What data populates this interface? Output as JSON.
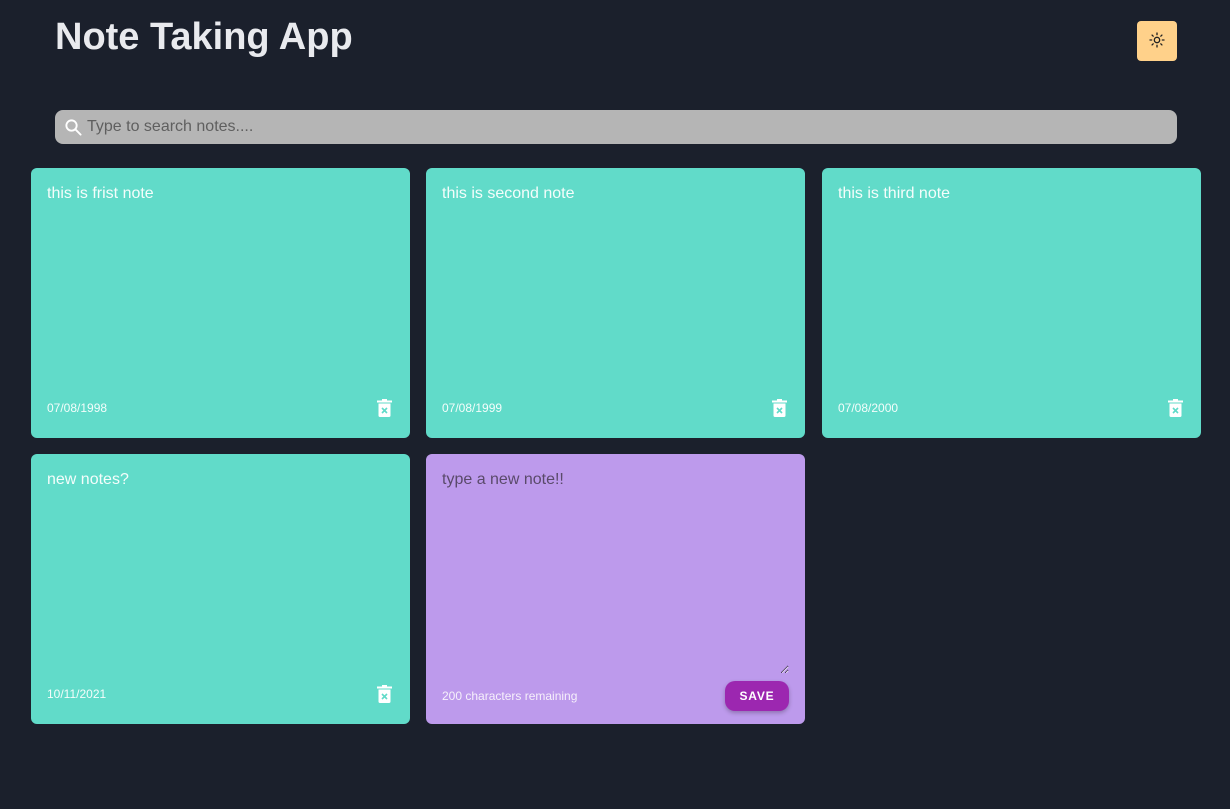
{
  "app": {
    "title": "Note Taking App",
    "theme_toggle_icon": "sun-icon"
  },
  "colors": {
    "background": "#1b202c",
    "note_card": "#61dbc9",
    "new_note_card": "#bd9aec",
    "save_button": "#9c27b0",
    "theme_toggle": "#ffd18a",
    "search_bg": "#b5b5b5"
  },
  "search": {
    "icon": "search-icon",
    "placeholder": "Type to search notes...."
  },
  "notes": [
    {
      "text": "this is frist note",
      "date": "07/08/1998",
      "delete_icon": "trash-icon"
    },
    {
      "text": "this is second note",
      "date": "07/08/1999",
      "delete_icon": "trash-icon"
    },
    {
      "text": "this is third note",
      "date": "07/08/2000",
      "delete_icon": "trash-icon"
    },
    {
      "text": "new notes?",
      "date": "10/11/2021",
      "delete_icon": "trash-icon"
    }
  ],
  "new_note": {
    "placeholder": "type a new note!!",
    "value": "",
    "chars_remaining": "200 characters remaining",
    "save_label": "SAVE"
  }
}
